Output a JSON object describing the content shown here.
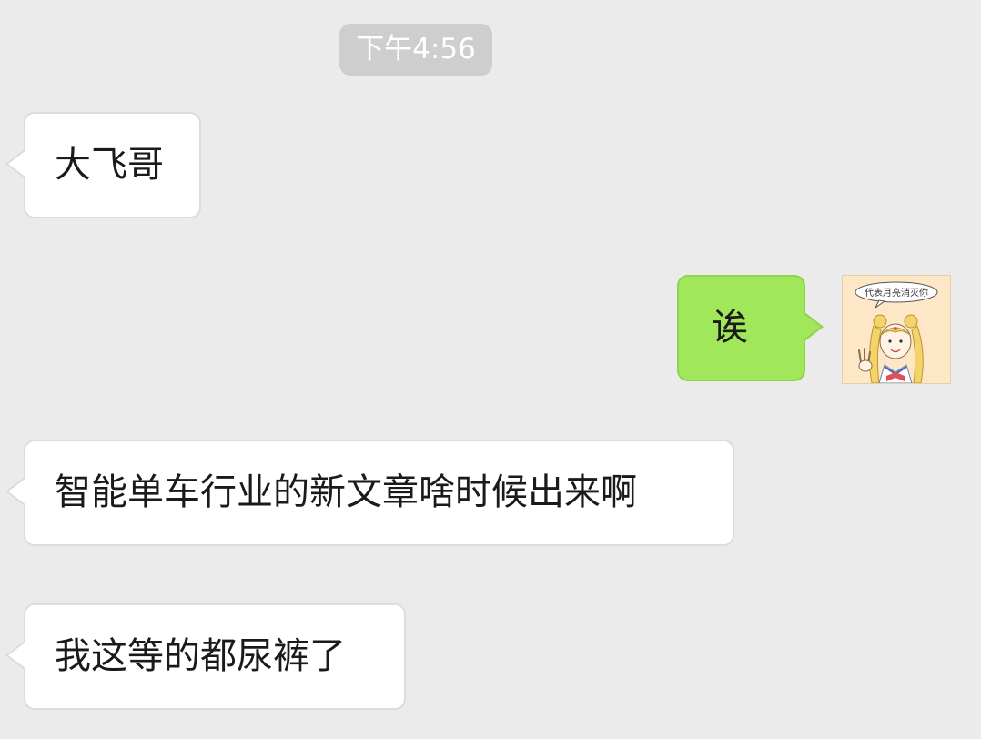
{
  "chat": {
    "timestamp": "下午4:56",
    "messages": [
      {
        "direction": "incoming",
        "text": "大飞哥"
      },
      {
        "direction": "outgoing",
        "text": "诶"
      },
      {
        "direction": "incoming",
        "text": "智能单车行业的新文章啥时候出来啊"
      },
      {
        "direction": "incoming",
        "text": "我这等的都尿裤了"
      }
    ],
    "avatar": {
      "icon": "sailor-moon-cartoon-avatar",
      "caption": "代表月亮消灭你"
    }
  },
  "colors": {
    "background": "#ebebeb",
    "incoming_bubble": "#ffffff",
    "outgoing_bubble": "#a0e75a",
    "timestamp_pill": "#cecece"
  }
}
